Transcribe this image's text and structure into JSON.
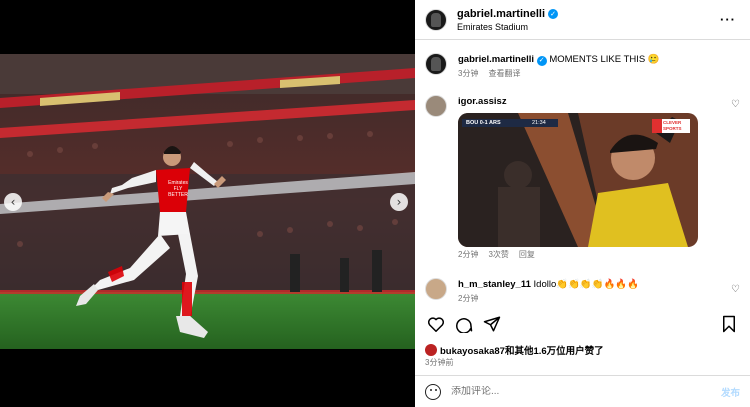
{
  "post": {
    "username": "gabriel.martinelli",
    "location": "Emirates Stadium",
    "more_icon": "ellipsis-icon",
    "caption": "MOMENTS LIKE THIS 🥲",
    "caption_time": "3分钟",
    "caption_translate": "查看翻译"
  },
  "media": {
    "prev_icon": "chevron-left-icon",
    "next_icon": "chevron-right-icon",
    "jersey_text": "Emirates FLY BETTER"
  },
  "comments": [
    {
      "username": "igor.assisz",
      "text": "",
      "embed": {
        "scoreboard": "BOU 0-1 ARS",
        "clock": "21:34",
        "brand": "CLEVER SPORTS"
      },
      "time": "2分钟",
      "likes": "3次赞",
      "reply": "回复"
    },
    {
      "username": "h_m_stanley_11",
      "text": "Idollo👏👏👏👏🔥🔥🔥",
      "time": "2分钟",
      "likes": "",
      "reply": ""
    }
  ],
  "actions": [
    "heart-icon",
    "comment-icon",
    "share-icon",
    "bookmark-icon"
  ],
  "likes_text": "bukayosaka87和其他1.6万位用户赞了",
  "post_time": "3分钟前",
  "add_comment": {
    "placeholder": "添加评论...",
    "post_label": "发布"
  },
  "colors": {
    "arsenal_red": "#db0007",
    "pitch_green": "#2f7a2a",
    "verified_blue": "#0095f6",
    "post_disabled": "#b3dbff"
  }
}
